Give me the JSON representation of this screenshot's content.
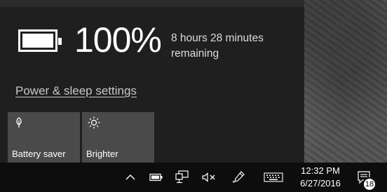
{
  "battery": {
    "percent_text": "100%",
    "level": 1.0,
    "remaining_text": "8 hours 28 minutes remaining",
    "settings_link": "Power & sleep settings"
  },
  "quick_actions": [
    {
      "label": "Battery saver",
      "icon": "battery-saver-icon"
    },
    {
      "label": "Brighter",
      "icon": "brightness-icon"
    }
  ],
  "taskbar": {
    "tray_icons": [
      "chevron-up-icon",
      "battery-icon",
      "network-icon",
      "volume-muted-icon",
      "pen-icon",
      "keyboard-icon"
    ],
    "time": "12:32 PM",
    "date": "6/27/2016",
    "notification_count": "18",
    "notification_icon": "action-center-icon"
  },
  "colors": {
    "flyout_bg": "#1f1f1f",
    "tile_bg": "#4a4a4a",
    "taskbar_bg": "#0d0d0d",
    "link": "#c8c8c8"
  }
}
